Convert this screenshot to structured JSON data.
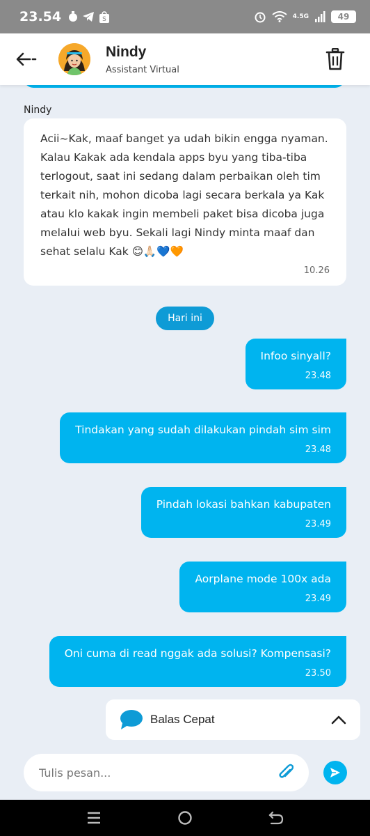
{
  "status_bar": {
    "time": "23.54",
    "network": "4.5G",
    "battery": "49"
  },
  "header": {
    "name": "Nindy",
    "subtitle": "Assistant Virtual"
  },
  "chat": {
    "sender": "Nindy",
    "bot_message": {
      "text": "Acii~Kak, maaf banget ya udah bikin engga nyaman. Kalau Kakak ada kendala apps byu yang tiba-tiba terlogout, saat ini sedang dalam perbaikan oleh tim terkait nih, mohon dicoba lagi secara berkala ya Kak atau klo kakak ingin membeli paket bisa dicoba juga melalui web byu. Sekali lagi Nindy minta maaf dan sehat selalu Kak 😊🙏🏻💙🧡",
      "time": "10.26"
    },
    "day_chip": "Hari ini",
    "user_messages": [
      {
        "text": "Infoo sinyall?",
        "time": "23.48"
      },
      {
        "text": "Tindakan yang sudah dilakukan pindah sim sim",
        "time": "23.48"
      },
      {
        "text": "Pindah lokasi bahkan kabupaten",
        "time": "23.49"
      },
      {
        "text": "Aorplane mode 100x ada",
        "time": "23.49"
      },
      {
        "text": "Oni cuma di read nggak ada solusi? Kompensasi?",
        "time": "23.50"
      }
    ]
  },
  "quick_reply": {
    "label": "Balas Cepat"
  },
  "composer": {
    "placeholder": "Tulis pesan..."
  },
  "colors": {
    "accent": "#00b4ef",
    "chip": "#0e9bd6",
    "background": "#e9eef5"
  }
}
